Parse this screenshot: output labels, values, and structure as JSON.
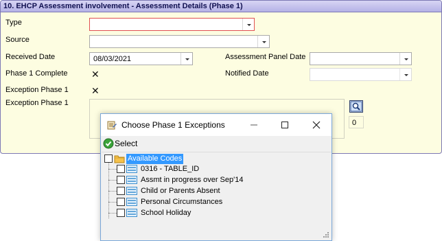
{
  "panel": {
    "title": "10. EHCP Assessment involvement - Assessment Details (Phase 1)"
  },
  "form": {
    "type": {
      "label": "Type",
      "value": ""
    },
    "source": {
      "label": "Source",
      "value": ""
    },
    "received_date": {
      "label": "Received Date",
      "value": "08/03/2021"
    },
    "assessment_panel_date": {
      "label": "Assessment Panel Date",
      "value": ""
    },
    "phase1_complete": {
      "label": "Phase 1 Complete",
      "checked": true
    },
    "notified_date": {
      "label": "Notified Date",
      "value": ""
    },
    "exception_phase1_flag": {
      "label": "Exception Phase 1",
      "checked": true
    },
    "exception_phase1_list": {
      "label": "Exception Phase 1",
      "value": "",
      "count": "0"
    }
  },
  "dialog": {
    "title": "Choose Phase 1 Exceptions",
    "toolbar": {
      "select_label": "Select"
    },
    "tree": {
      "root": "Available Codes",
      "items": [
        "0316 - TABLE_ID",
        "Assmt in progress over Sep'14",
        "Child or Parents Absent",
        "Personal Circumstances",
        "School Holiday"
      ]
    }
  },
  "colors": {
    "panel_bg": "#fdfde1",
    "header_border": "#7c78b4",
    "required_border": "#e05050",
    "selection_bg": "#3399ff"
  },
  "icons": [
    "dropdown-arrow-icon",
    "x-mark-icon",
    "lookup-search-icon",
    "dialog-app-icon",
    "minimize-icon",
    "maximize-icon",
    "close-icon",
    "green-check-icon",
    "folder-icon",
    "code-item-icon",
    "resize-grip-icon"
  ]
}
